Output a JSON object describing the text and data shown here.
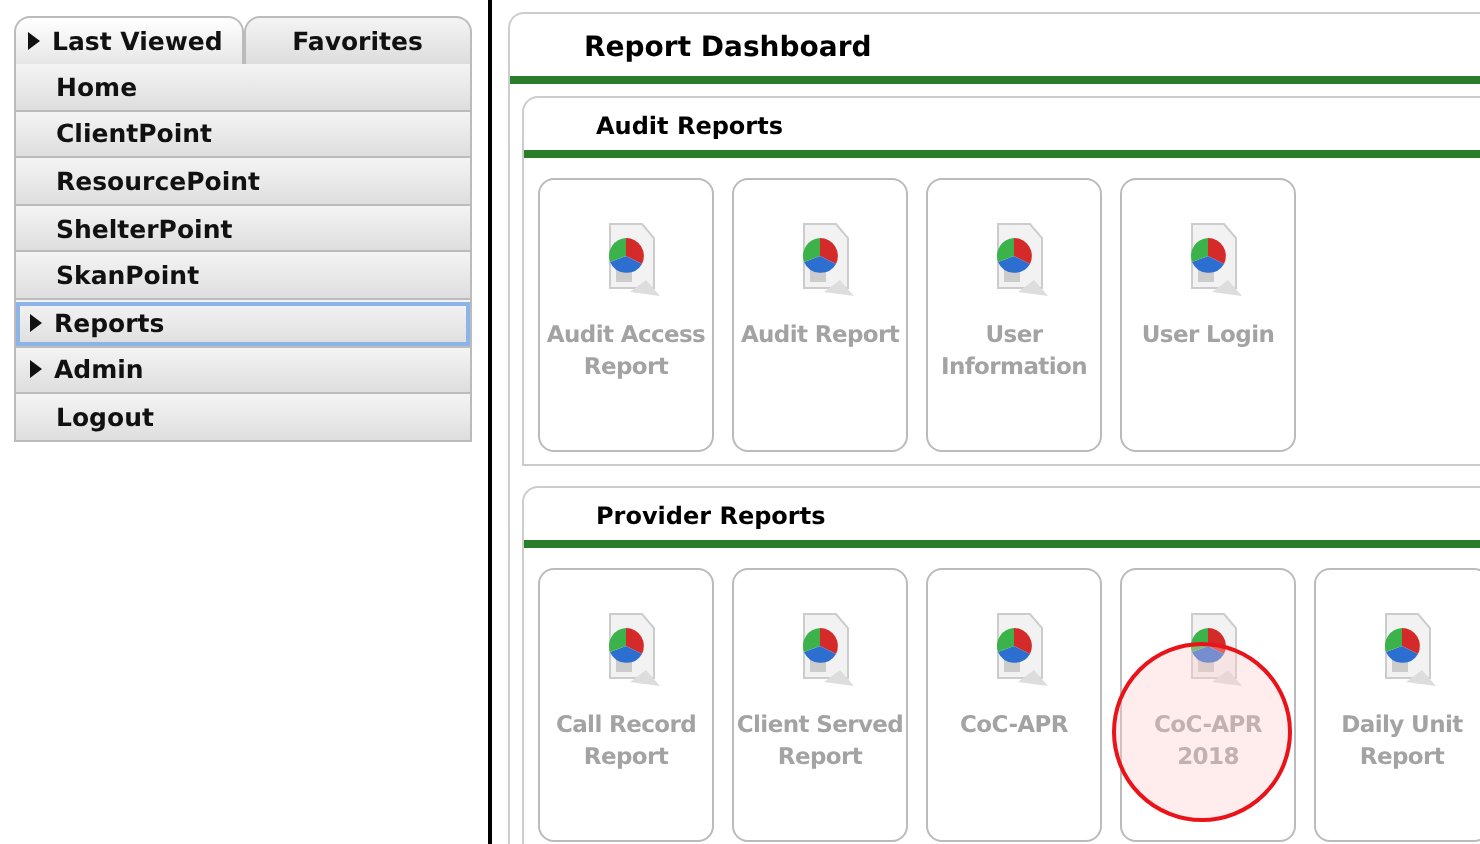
{
  "sidebar": {
    "tabs": [
      {
        "label": "Last Viewed",
        "selected": true,
        "expandable": true
      },
      {
        "label": "Favorites",
        "selected": false,
        "expandable": false
      }
    ],
    "items": [
      {
        "label": "Home",
        "expandable": false,
        "selected": false
      },
      {
        "label": "ClientPoint",
        "expandable": false,
        "selected": false
      },
      {
        "label": "ResourcePoint",
        "expandable": false,
        "selected": false
      },
      {
        "label": "ShelterPoint",
        "expandable": false,
        "selected": false
      },
      {
        "label": "SkanPoint",
        "expandable": false,
        "selected": false
      },
      {
        "label": "Reports",
        "expandable": true,
        "selected": true
      },
      {
        "label": "Admin",
        "expandable": true,
        "selected": false
      },
      {
        "label": "Logout",
        "expandable": false,
        "selected": false
      }
    ]
  },
  "dashboard": {
    "title": "Report Dashboard",
    "sections": [
      {
        "title": "Audit Reports",
        "reports": [
          {
            "label": "Audit Access Report",
            "highlighted": false
          },
          {
            "label": "Audit Report",
            "highlighted": false
          },
          {
            "label": "User Information",
            "highlighted": false
          },
          {
            "label": "User Login",
            "highlighted": false
          }
        ]
      },
      {
        "title": "Provider Reports",
        "reports": [
          {
            "label": "Call Record Report",
            "highlighted": false
          },
          {
            "label": "Client Served Report",
            "highlighted": false
          },
          {
            "label": "CoC-APR",
            "highlighted": false
          },
          {
            "label": "CoC-APR 2018",
            "highlighted": true
          },
          {
            "label": "Daily Unit Report",
            "highlighted": false
          }
        ]
      }
    ]
  }
}
